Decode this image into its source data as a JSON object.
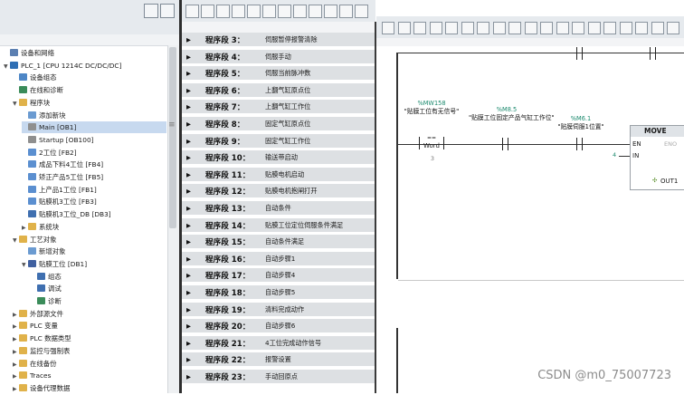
{
  "tree": {
    "items": [
      {
        "label": "设备和网络",
        "level": 0,
        "icon": "network-icon",
        "expander": ""
      },
      {
        "label": "PLC_1 [CPU 1214C DC/DC/DC]",
        "level": 0,
        "icon": "plc-icon",
        "expander": "▼"
      },
      {
        "label": "设备组态",
        "level": 1,
        "icon": "device-config-icon",
        "expander": ""
      },
      {
        "label": "在线和诊断",
        "level": 1,
        "icon": "diagnostics-icon",
        "expander": ""
      },
      {
        "label": "程序块",
        "level": 1,
        "icon": "folder-icon",
        "expander": "▼"
      },
      {
        "label": "添加新块",
        "level": 2,
        "icon": "add-block-icon",
        "expander": ""
      },
      {
        "label": "Main [OB1]",
        "level": 2,
        "icon": "ob-block-icon",
        "expander": "",
        "selected": true
      },
      {
        "label": "Startup [OB100]",
        "level": 2,
        "icon": "ob-block-icon",
        "expander": ""
      },
      {
        "label": "2工位 [FB2]",
        "level": 2,
        "icon": "fb-block-icon",
        "expander": ""
      },
      {
        "label": "成品下料4工位 [FB4]",
        "level": 2,
        "icon": "fb-block-icon",
        "expander": ""
      },
      {
        "label": "矫正产品5工位 [FB5]",
        "level": 2,
        "icon": "fb-block-icon",
        "expander": ""
      },
      {
        "label": "上产品1工位 [FB1]",
        "level": 2,
        "icon": "fb-block-icon",
        "expander": ""
      },
      {
        "label": "贴膜机3工位 [FB3]",
        "level": 2,
        "icon": "fb-block-icon",
        "expander": ""
      },
      {
        "label": "贴膜机3工位_DB [DB3]",
        "level": 2,
        "icon": "db-block-icon",
        "expander": ""
      },
      {
        "label": "系统块",
        "level": 2,
        "icon": "folder-icon",
        "expander": "▶"
      },
      {
        "label": "工艺对象",
        "level": 1,
        "icon": "folder-icon",
        "expander": "▼"
      },
      {
        "label": "新增对象",
        "level": 2,
        "icon": "add-object-icon",
        "expander": ""
      },
      {
        "label": "贴膜工位 [DB1]",
        "level": 2,
        "icon": "axis-icon",
        "expander": "▼"
      },
      {
        "label": "组态",
        "level": 3,
        "icon": "config-icon",
        "expander": ""
      },
      {
        "label": "调试",
        "level": 3,
        "icon": "commissioning-icon",
        "expander": ""
      },
      {
        "label": "诊断",
        "level": 3,
        "icon": "diagnostics-icon",
        "expander": ""
      },
      {
        "label": "外部源文件",
        "level": 1,
        "icon": "folder-icon",
        "expander": "▶"
      },
      {
        "label": "PLC 变量",
        "level": 1,
        "icon": "folder-icon",
        "expander": "▶"
      },
      {
        "label": "PLC 数据类型",
        "level": 1,
        "icon": "folder-icon",
        "expander": "▶"
      },
      {
        "label": "监控与强制表",
        "level": 1,
        "icon": "folder-icon",
        "expander": "▶"
      },
      {
        "label": "在线备份",
        "level": 1,
        "icon": "folder-icon",
        "expander": "▶"
      },
      {
        "label": "Traces",
        "level": 1,
        "icon": "folder-icon",
        "expander": "▶"
      },
      {
        "label": "设备代理数据",
        "level": 1,
        "icon": "folder-icon",
        "expander": "▶"
      }
    ]
  },
  "networks": [
    {
      "label": "程序段 3：",
      "comment": "伺服暂停报警清除"
    },
    {
      "label": "程序段 4：",
      "comment": "伺服手动"
    },
    {
      "label": "程序段 5：",
      "comment": "伺服当前脉冲数"
    },
    {
      "label": "程序段 6：",
      "comment": "上翻气缸原点位"
    },
    {
      "label": "程序段 7：",
      "comment": "上翻气缸工作位"
    },
    {
      "label": "程序段 8：",
      "comment": "固定气缸原点位"
    },
    {
      "label": "程序段 9：",
      "comment": "固定气缸工作位"
    },
    {
      "label": "程序段 10：",
      "comment": "输送带启动"
    },
    {
      "label": "程序段 11：",
      "comment": "贴膜电机启动"
    },
    {
      "label": "程序段 12：",
      "comment": "贴膜电机抱闸打开"
    },
    {
      "label": "程序段 13：",
      "comment": "自动条件"
    },
    {
      "label": "程序段 14：",
      "comment": "贴膜工位定位伺服条件满足"
    },
    {
      "label": "程序段 15：",
      "comment": "自动条件满足"
    },
    {
      "label": "程序段 16：",
      "comment": "自动步骤1"
    },
    {
      "label": "程序段 17：",
      "comment": "自动步骤4"
    },
    {
      "label": "程序段 18：",
      "comment": "自动步骤5"
    },
    {
      "label": "程序段 19：",
      "comment": "清料完成动作"
    },
    {
      "label": "程序段 20：",
      "comment": "自动步骤6"
    },
    {
      "label": "程序段 21：",
      "comment": "4工位完成动作信号"
    },
    {
      "label": "程序段 22：",
      "comment": "报警设置"
    },
    {
      "label": "程序段 23：",
      "comment": "手动回原点"
    }
  ],
  "ladder": {
    "contact1": {
      "operand": "%MW158",
      "comment": "\"贴膜工位有无信号\"",
      "type_top": "==",
      "type_bottom": "Word",
      "value": "3"
    },
    "contact2": {
      "operand": "%M8.5",
      "comment": "\"贴膜工位固定产品气缸工作位\""
    },
    "contact3": {
      "operand": "%M6.1",
      "comment": "\"贴膜伺服1位置\""
    },
    "move": {
      "title": "MOVE",
      "en": "EN",
      "eno": "ENO",
      "in": "IN",
      "in_value": "4",
      "out": "OUT1"
    }
  },
  "watermark": "CSDN @m0_75007723"
}
